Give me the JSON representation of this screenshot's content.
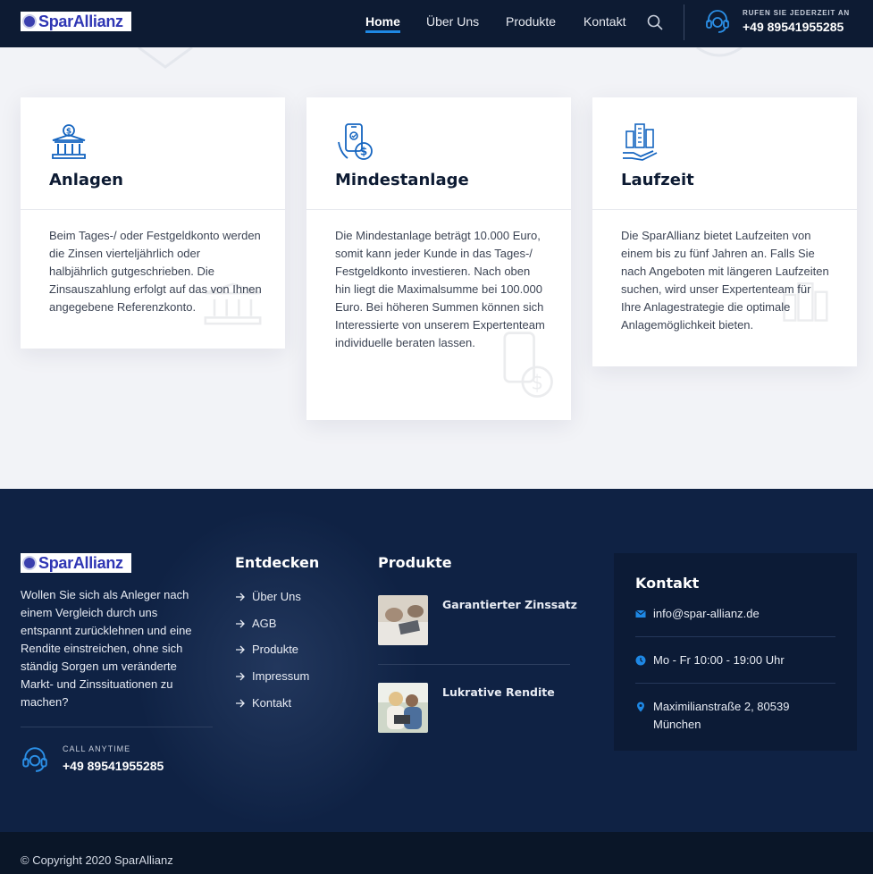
{
  "header": {
    "logo_text": "SparAllianz",
    "nav": [
      {
        "label": "Home",
        "active": true
      },
      {
        "label": "Über Uns",
        "active": false
      },
      {
        "label": "Produkte",
        "active": false
      },
      {
        "label": "Kontakt",
        "active": false
      }
    ],
    "call_label": "RUFEN SIE JEDERZEIT AN",
    "phone": "+49 89541955285",
    "icons": {
      "search": "search-icon",
      "support": "headset-icon"
    }
  },
  "cards": [
    {
      "icon": "bank-icon",
      "title": "Anlagen",
      "text": "Beim Tages-/ oder Festgeldkonto werden die Zinsen vierteljährlich oder halbjährlich gutgeschrieben. Die Zinsauszahlung erfolgt auf das von Ihnen angegebene Referenzkonto."
    },
    {
      "icon": "mobile-payment-icon",
      "title": "Mindestanlage",
      "text": "Die Mindestanlage beträgt 10.000 Euro, somit kann jeder Kunde in das Tages-/ Festgeldkonto investieren. Nach oben hin liegt die Maximalsumme bei 100.000 Euro. Bei höheren Summen können sich Interessierte von unserem Expertenteam individuelle beraten lassen."
    },
    {
      "icon": "city-hand-icon",
      "title": "Laufzeit",
      "text": "Die SparAllianz bietet Laufzeiten von einem bis zu fünf Jahren an. Falls Sie nach Angeboten mit längeren Laufzeiten suchen, wird unser Expertenteam für Ihre Anlagestrategie die optimale Anlagemöglichkeit bieten."
    }
  ],
  "footer": {
    "logo_text": "SparAllianz",
    "description": "Wollen Sie sich als Anleger nach einem Vergleich durch uns entspannt zurücklehnen und eine Rendite einstreichen, ohne sich ständig Sorgen um veränderte Markt- und Zinssituationen zu machen?",
    "call_label": "CALL ANYTIME",
    "phone": "+49 89541955285",
    "explore_title": "Entdecken",
    "explore_links": [
      "Über Uns",
      "AGB",
      "Produkte",
      "Impressum",
      "Kontakt"
    ],
    "products_title": "Produkte",
    "products": [
      {
        "title": "Garantierter Zinssatz"
      },
      {
        "title": "Lukrative Rendite"
      }
    ],
    "contact_title": "Kontakt",
    "contact": {
      "email": "info@spar-allianz.de",
      "hours": "Mo - Fr 10:00 - 19:00 Uhr",
      "address_line1": "Maximilianstraße 2, 80539",
      "address_line2": "München"
    },
    "copyright": "© Copyright 2020 SparAllianz"
  },
  "colors": {
    "navy": "#0d1b33",
    "accent": "#1e88e5",
    "footer": "#0f2244"
  }
}
